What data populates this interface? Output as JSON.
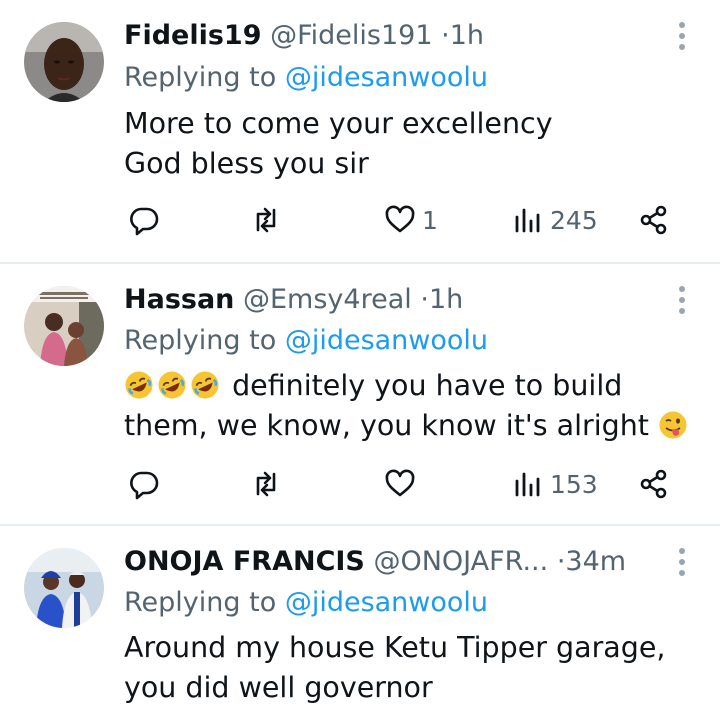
{
  "tweets": [
    {
      "name": "Fidelis19",
      "handle": "@Fidelis191",
      "separator": "·",
      "time": "1h",
      "replying_prefix": "Replying to",
      "replying_handle": "@jidesanwoolu",
      "body_lines": [
        "More to come your excellency",
        "God bless you sir"
      ],
      "likes": "1",
      "views": "245",
      "avatar_icon": "person-photo"
    },
    {
      "name": "Hassan",
      "handle": "@Emsy4real",
      "separator": "·",
      "time": "1h",
      "replying_prefix": "Replying to",
      "replying_handle": "@jidesanwoolu",
      "body_lines": [
        "definitely you have to build",
        "them, we know, you know it's alright"
      ],
      "emojis": [
        "rolling-on-floor-laughing",
        "rolling-on-floor-laughing",
        "rolling-on-floor-laughing",
        "winking-face-with-tongue"
      ],
      "likes": "",
      "views": "153",
      "avatar_icon": "children-photo"
    },
    {
      "name": "ONOJA FRANCIS",
      "handle": "@ONOJAFR...",
      "separator": "·",
      "time": "34m",
      "replying_prefix": "Replying to",
      "replying_handle": "@jidesanwoolu",
      "body_lines": [
        "Around my house Ketu Tipper garage,",
        "you did well governor"
      ],
      "avatar_icon": "couple-photo"
    }
  ],
  "colors": {
    "text": "#0f1419",
    "secondary": "#536471",
    "link": "#1d9bf0",
    "divider": "#e6ecf0"
  },
  "icons": {
    "reply": "reply-icon",
    "retweet": "retweet-icon",
    "like": "like-icon",
    "views": "views-icon",
    "share": "share-icon",
    "more": "more-options-icon"
  }
}
